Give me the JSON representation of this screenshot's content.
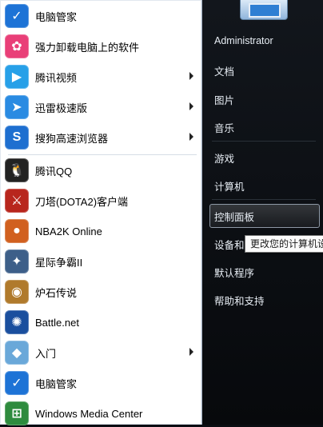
{
  "left_items": [
    {
      "label": "电脑管家",
      "icon": "tencent-pc-manager-icon",
      "color": "#1d73d6",
      "glyph": "✓",
      "arrow": false
    },
    {
      "label": "强力卸载电脑上的软件",
      "icon": "uninstall-software-icon",
      "color": "#e93f78",
      "glyph": "✿",
      "arrow": false
    },
    {
      "label": "腾讯视频",
      "icon": "tencent-video-icon",
      "color": "#27a0e8",
      "glyph": "▶",
      "arrow": true
    },
    {
      "label": "迅雷极速版",
      "icon": "thunder-icon",
      "color": "#2a8be2",
      "glyph": "➤",
      "arrow": true
    },
    {
      "label": "搜狗高速浏览器",
      "icon": "sogou-browser-icon",
      "color": "#1e6fd0",
      "glyph": "S",
      "arrow": true
    },
    {
      "label": "腾讯QQ",
      "icon": "qq-penguin-icon",
      "color": "#222222",
      "glyph": "🐧",
      "arrow": false
    },
    {
      "label": "刀塔(DOTA2)客户端",
      "icon": "dota2-icon",
      "color": "#b8261d",
      "glyph": "⚔",
      "arrow": false
    },
    {
      "label": "NBA2K Online",
      "icon": "basketball-icon",
      "color": "#d1601f",
      "glyph": "●",
      "arrow": false
    },
    {
      "label": "星际争霸II",
      "icon": "starcraft2-icon",
      "color": "#3d5f89",
      "glyph": "✦",
      "arrow": false
    },
    {
      "label": "炉石传说",
      "icon": "hearthstone-icon",
      "color": "#b07a2c",
      "glyph": "◉",
      "arrow": false
    },
    {
      "label": "Battle.net",
      "icon": "battlenet-icon",
      "color": "#1a4f9e",
      "glyph": "✺",
      "arrow": false
    },
    {
      "label": "入门",
      "icon": "getting-started-icon",
      "color": "#6aa8d9",
      "glyph": "◆",
      "arrow": true
    },
    {
      "label": "电脑管家",
      "icon": "tencent-pc-manager-icon",
      "color": "#1d73d6",
      "glyph": "✓",
      "arrow": false
    },
    {
      "label": "Windows Media Center",
      "icon": "media-center-icon",
      "color": "#2e8b3e",
      "glyph": "⊞",
      "arrow": false
    }
  ],
  "right_items": [
    {
      "label": "Administrator"
    },
    {
      "label": "文档"
    },
    {
      "label": "图片"
    },
    {
      "label": "音乐"
    },
    {
      "label": "游戏"
    },
    {
      "label": "计算机"
    },
    {
      "label": "控制面板"
    },
    {
      "label": "设备和"
    },
    {
      "label": "默认程序"
    },
    {
      "label": "帮助和支持"
    }
  ],
  "tooltip": "更改您的计算机设"
}
